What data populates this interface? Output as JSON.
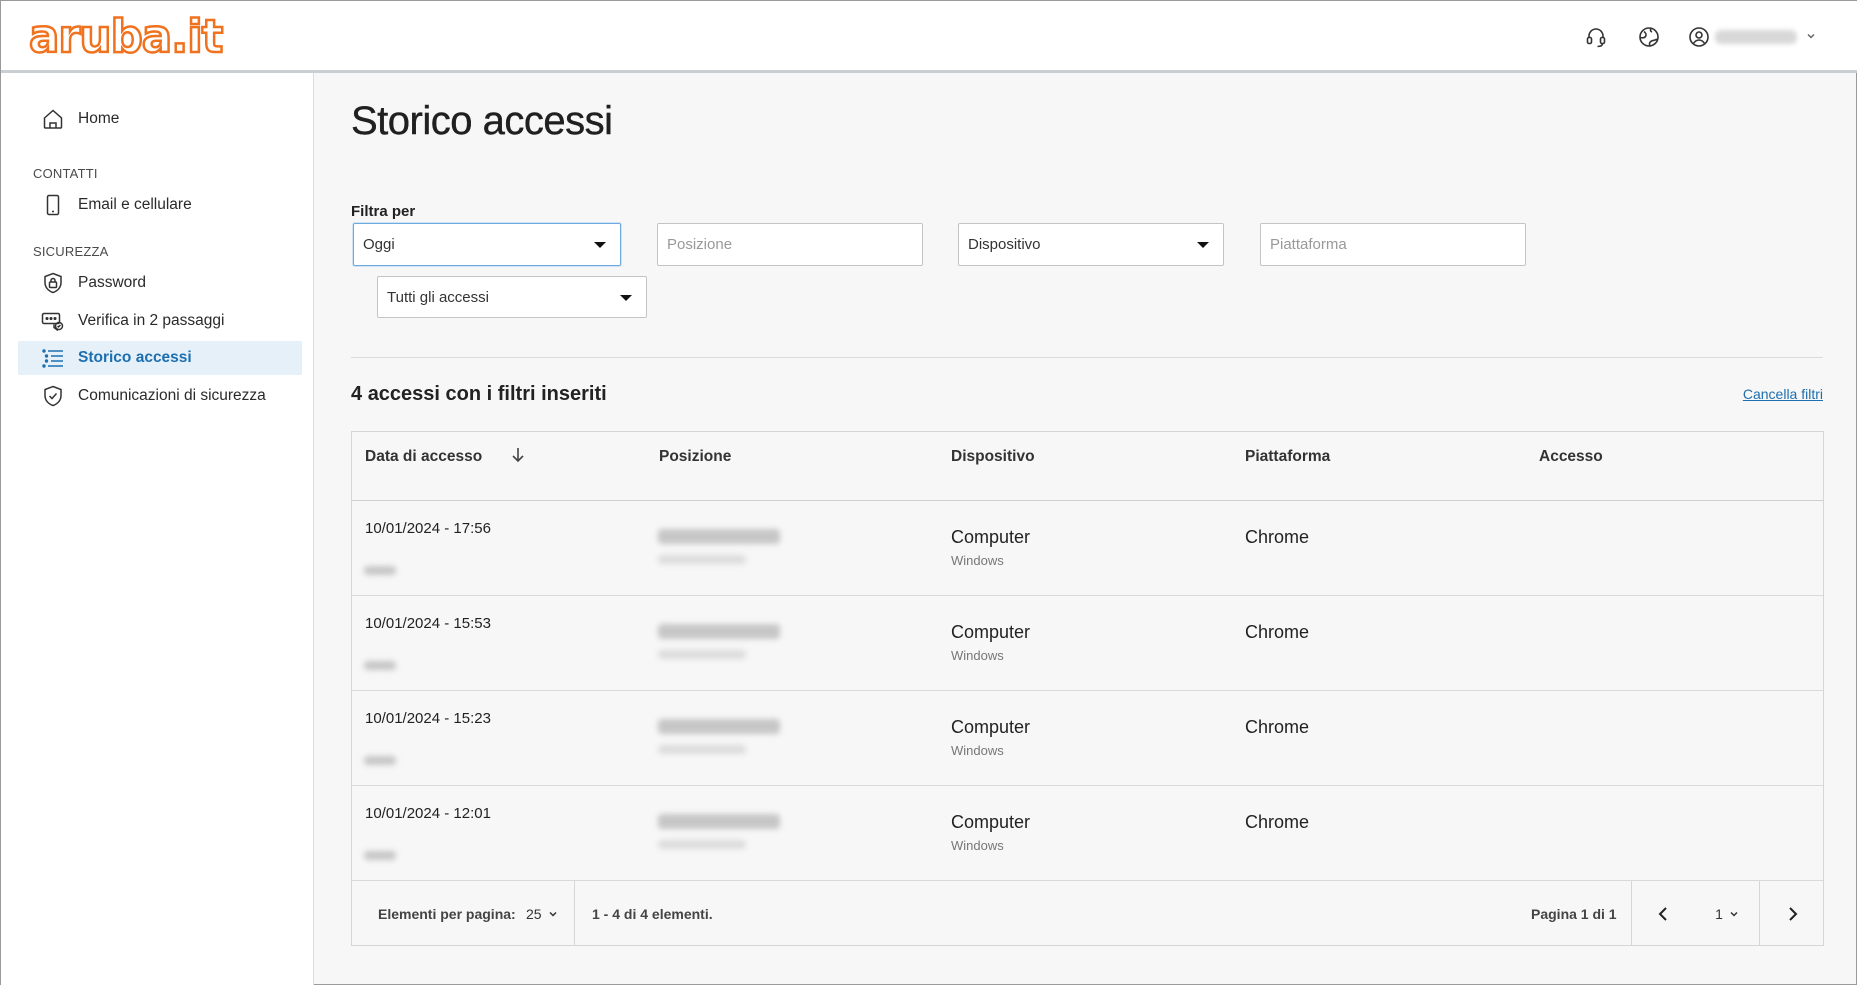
{
  "brand": {
    "logo_text": "aruba.it",
    "accent": "#f0721e",
    "link_color": "#1d6fb0"
  },
  "header": {
    "icons": [
      "headset-icon",
      "support-globe-icon",
      "user-circle-icon",
      "chevron-down-icon"
    ]
  },
  "sidebar": {
    "home": "Home",
    "section_contacts": "CONTATTI",
    "email_phone": "Email e cellulare",
    "section_security": "SICUREZZA",
    "password": "Password",
    "two_step": "Verifica in 2 passaggi",
    "access_history": "Storico accessi",
    "security_comms": "Comunicazioni di sicurezza"
  },
  "page": {
    "title": "Storico accessi"
  },
  "filters": {
    "label": "Filtra per",
    "period_value": "Oggi",
    "position_placeholder": "Posizione",
    "device_value": "Dispositivo",
    "platform_placeholder": "Piattaforma",
    "access_value": "Tutti gli accessi"
  },
  "results": {
    "count": "4",
    "count_text": "accessi con i filtri inseriti",
    "clear_filters": "Cancella filtri"
  },
  "table": {
    "columns": [
      "Data di accesso",
      "Posizione",
      "Dispositivo",
      "Piattaforma",
      "Accesso"
    ],
    "rows": [
      {
        "date": "10/01/2024 - 17:56",
        "device": "Computer",
        "os": "Windows",
        "platform": "Chrome"
      },
      {
        "date": "10/01/2024 - 15:53",
        "device": "Computer",
        "os": "Windows",
        "platform": "Chrome"
      },
      {
        "date": "10/01/2024 - 15:23",
        "device": "Computer",
        "os": "Windows",
        "platform": "Chrome"
      },
      {
        "date": "10/01/2024 - 12:01",
        "device": "Computer",
        "os": "Windows",
        "platform": "Chrome"
      }
    ]
  },
  "pagination": {
    "per_page_label": "Elementi per pagina:",
    "per_page_value": "25",
    "range_text": "1 - 4 di 4 elementi.",
    "page_text": "Pagina 1 di 1",
    "current_page": "1"
  }
}
